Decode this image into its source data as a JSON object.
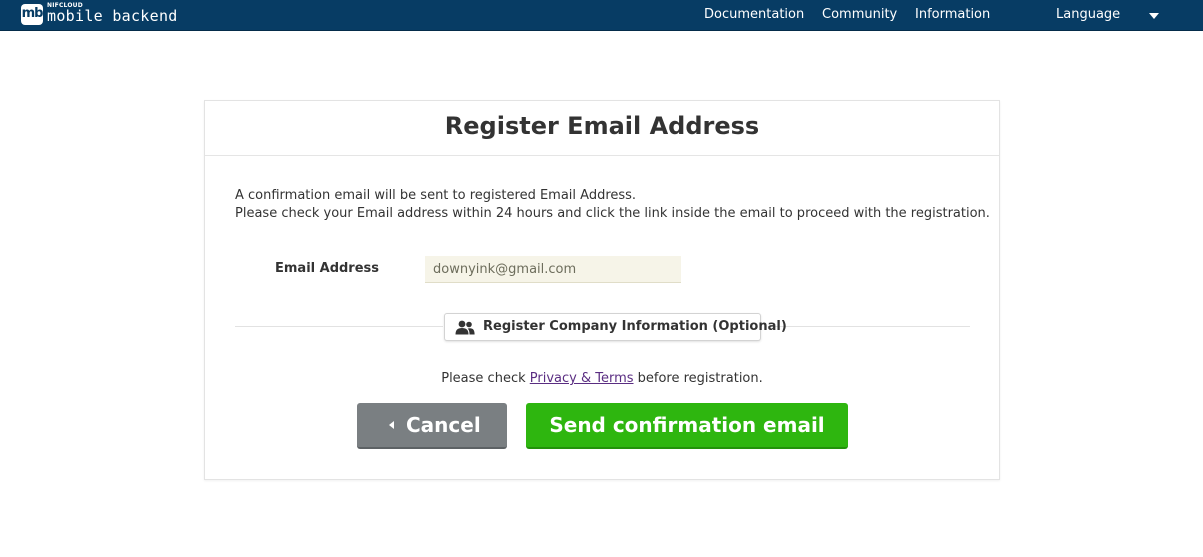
{
  "header": {
    "logo_small": "NIFCLOUD",
    "logo_text": "mobile backend",
    "logo_mark": "mb",
    "nav": [
      "Documentation",
      "Community",
      "Information"
    ],
    "language_label": "Language",
    "background_color": "#073c64"
  },
  "card": {
    "title": "Register Email Address",
    "description_line1": "A confirmation email will be sent to registered Email Address.",
    "description_line2": "Please check your Email address within 24 hours and click the link inside the email to proceed with the registration.",
    "email_label": "Email Address",
    "email_value": "downyink@gmail.com",
    "company_button_label": "Register Company Information (Optional)",
    "company_button_icon": "users-icon",
    "privacy_prefix": "Please check ",
    "privacy_link": "Privacy & Terms",
    "privacy_suffix": " before registration.",
    "cancel_label": "Cancel",
    "send_label": "Send confirmation email",
    "colors": {
      "cancel": "#7a7f82",
      "send": "#2eb60f",
      "input_bg": "#f6f4e8",
      "link": "#5a2d82"
    }
  }
}
